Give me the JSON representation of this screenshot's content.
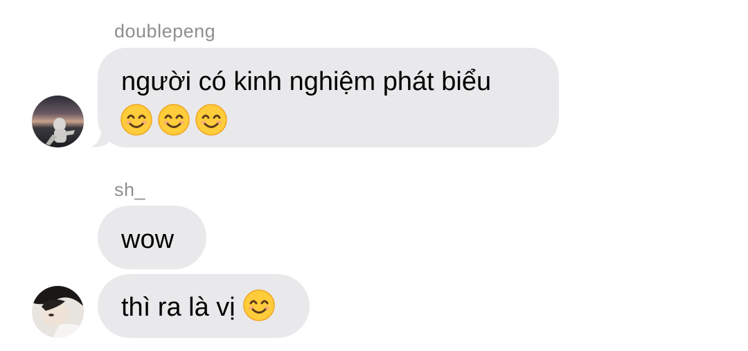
{
  "messages": [
    {
      "sender": "doublepeng",
      "avatar_icon": "user-avatar-photo",
      "lines": [
        "người có kinh nghiệm phát biểu"
      ],
      "emojis": [
        "smiling-face-emoji",
        "smiling-face-emoji",
        "smiling-face-emoji"
      ]
    },
    {
      "sender": "sh_",
      "avatar_icon": "user-avatar-photo",
      "bubbles": [
        {
          "text": "wow"
        },
        {
          "text": "thì ra là vị",
          "emoji": "smiling-face-emoji"
        }
      ]
    }
  ],
  "colors": {
    "bubble_background": "#e9e9eb",
    "sender_name": "#8e8e93",
    "text": "#000000"
  }
}
